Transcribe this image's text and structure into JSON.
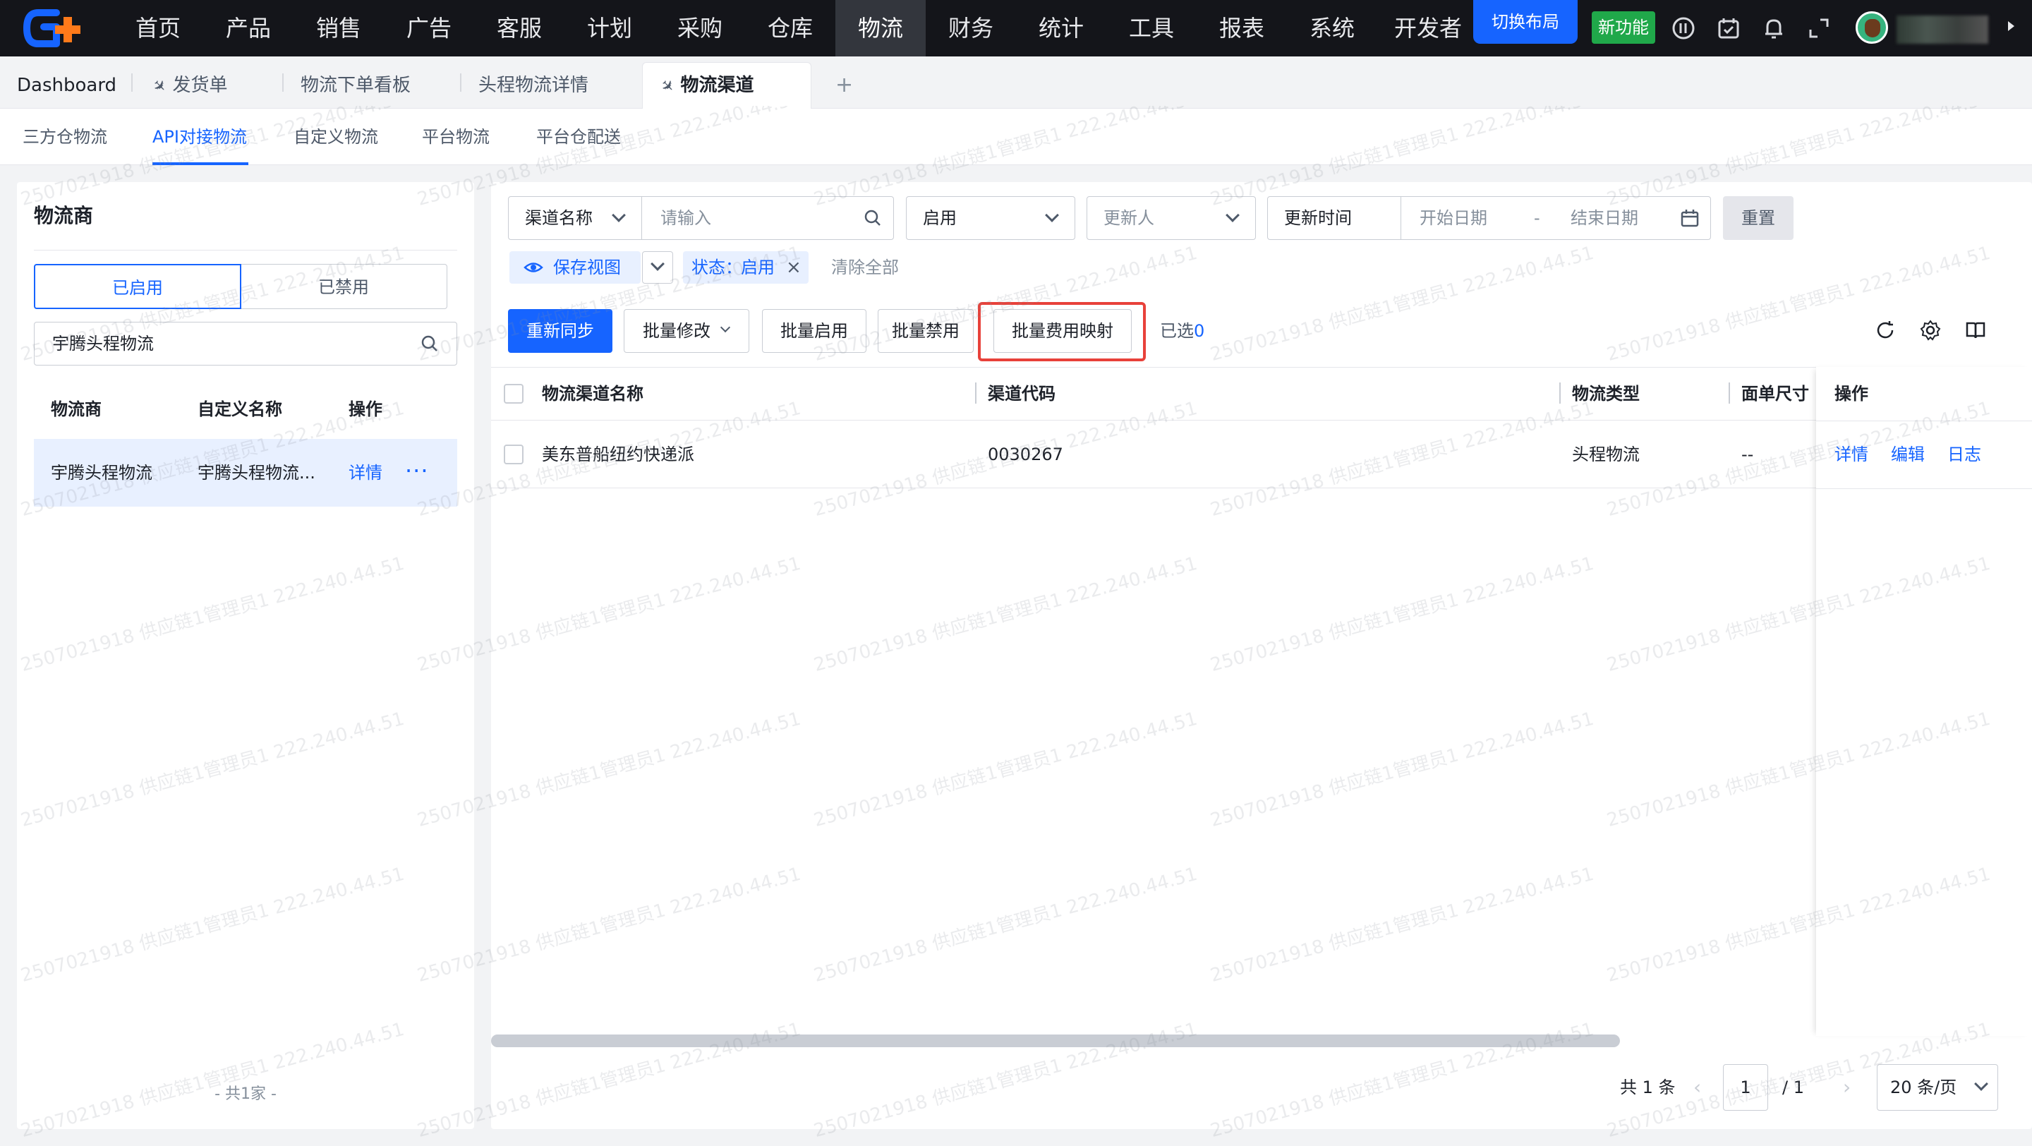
{
  "nav": {
    "items": [
      "首页",
      "产品",
      "销售",
      "广告",
      "客服",
      "计划",
      "采购",
      "仓库",
      "物流",
      "财务",
      "统计",
      "工具",
      "报表",
      "系统",
      "开发者"
    ],
    "active": "物流",
    "switch_layout": "切换布局",
    "new_feature": "新功能"
  },
  "page_tabs": [
    "Dashboard",
    "发货单",
    "物流下单看板",
    "头程物流详情",
    "物流渠道"
  ],
  "page_tab_add": "+",
  "sub_tabs": [
    "三方仓物流",
    "API对接物流",
    "自定义物流",
    "平台物流",
    "平台仓配送"
  ],
  "left": {
    "title": "物流商",
    "seg_enabled": "已启用",
    "seg_disabled": "已禁用",
    "search_value": "宇腾头程物流",
    "columns": [
      "物流商",
      "自定义名称",
      "操作"
    ],
    "row": {
      "carrier": "宇腾头程物流",
      "custom_name": "宇腾头程物流...",
      "detail": "详情",
      "more": "···"
    },
    "footer": "- 共1家 -"
  },
  "filters": {
    "field_select": "渠道名称",
    "field_placeholder": "请输入",
    "status_select": "启用",
    "updater_placeholder": "更新人",
    "time_select": "更新时间",
    "start_placeholder": "开始日期",
    "range_sep": "-",
    "end_placeholder": "结束日期",
    "reset": "重置",
    "save_view": "保存视图",
    "tag_label": "状态：",
    "tag_value": "启用",
    "clear_all": "清除全部"
  },
  "toolbar": {
    "resync": "重新同步",
    "batch_edit": "批量修改",
    "batch_enable": "批量启用",
    "batch_disable": "批量禁用",
    "batch_fee_map": "批量费用映射",
    "selected_label": "已选",
    "selected_count": "0"
  },
  "table": {
    "columns": [
      "物流渠道名称",
      "渠道代码",
      "物流类型",
      "面单尺寸",
      "操作"
    ],
    "rows": [
      {
        "name": "美东普船纽约快递派",
        "code": "0030267",
        "type": "头程物流",
        "size": "--",
        "actions": [
          "详情",
          "编辑",
          "日志"
        ]
      }
    ]
  },
  "pagination": {
    "total": "共 1 条",
    "prev": "‹",
    "page": "1",
    "of": "/ 1",
    "next": "›",
    "page_size": "20 条/页"
  },
  "watermark": "2507021918 供应链1管理员1 222.240.44.51",
  "colors": {
    "accent": "#1664ff",
    "nav_bg": "#14151a",
    "new_feature": "#20a84a",
    "highlight": "#e8413a"
  }
}
